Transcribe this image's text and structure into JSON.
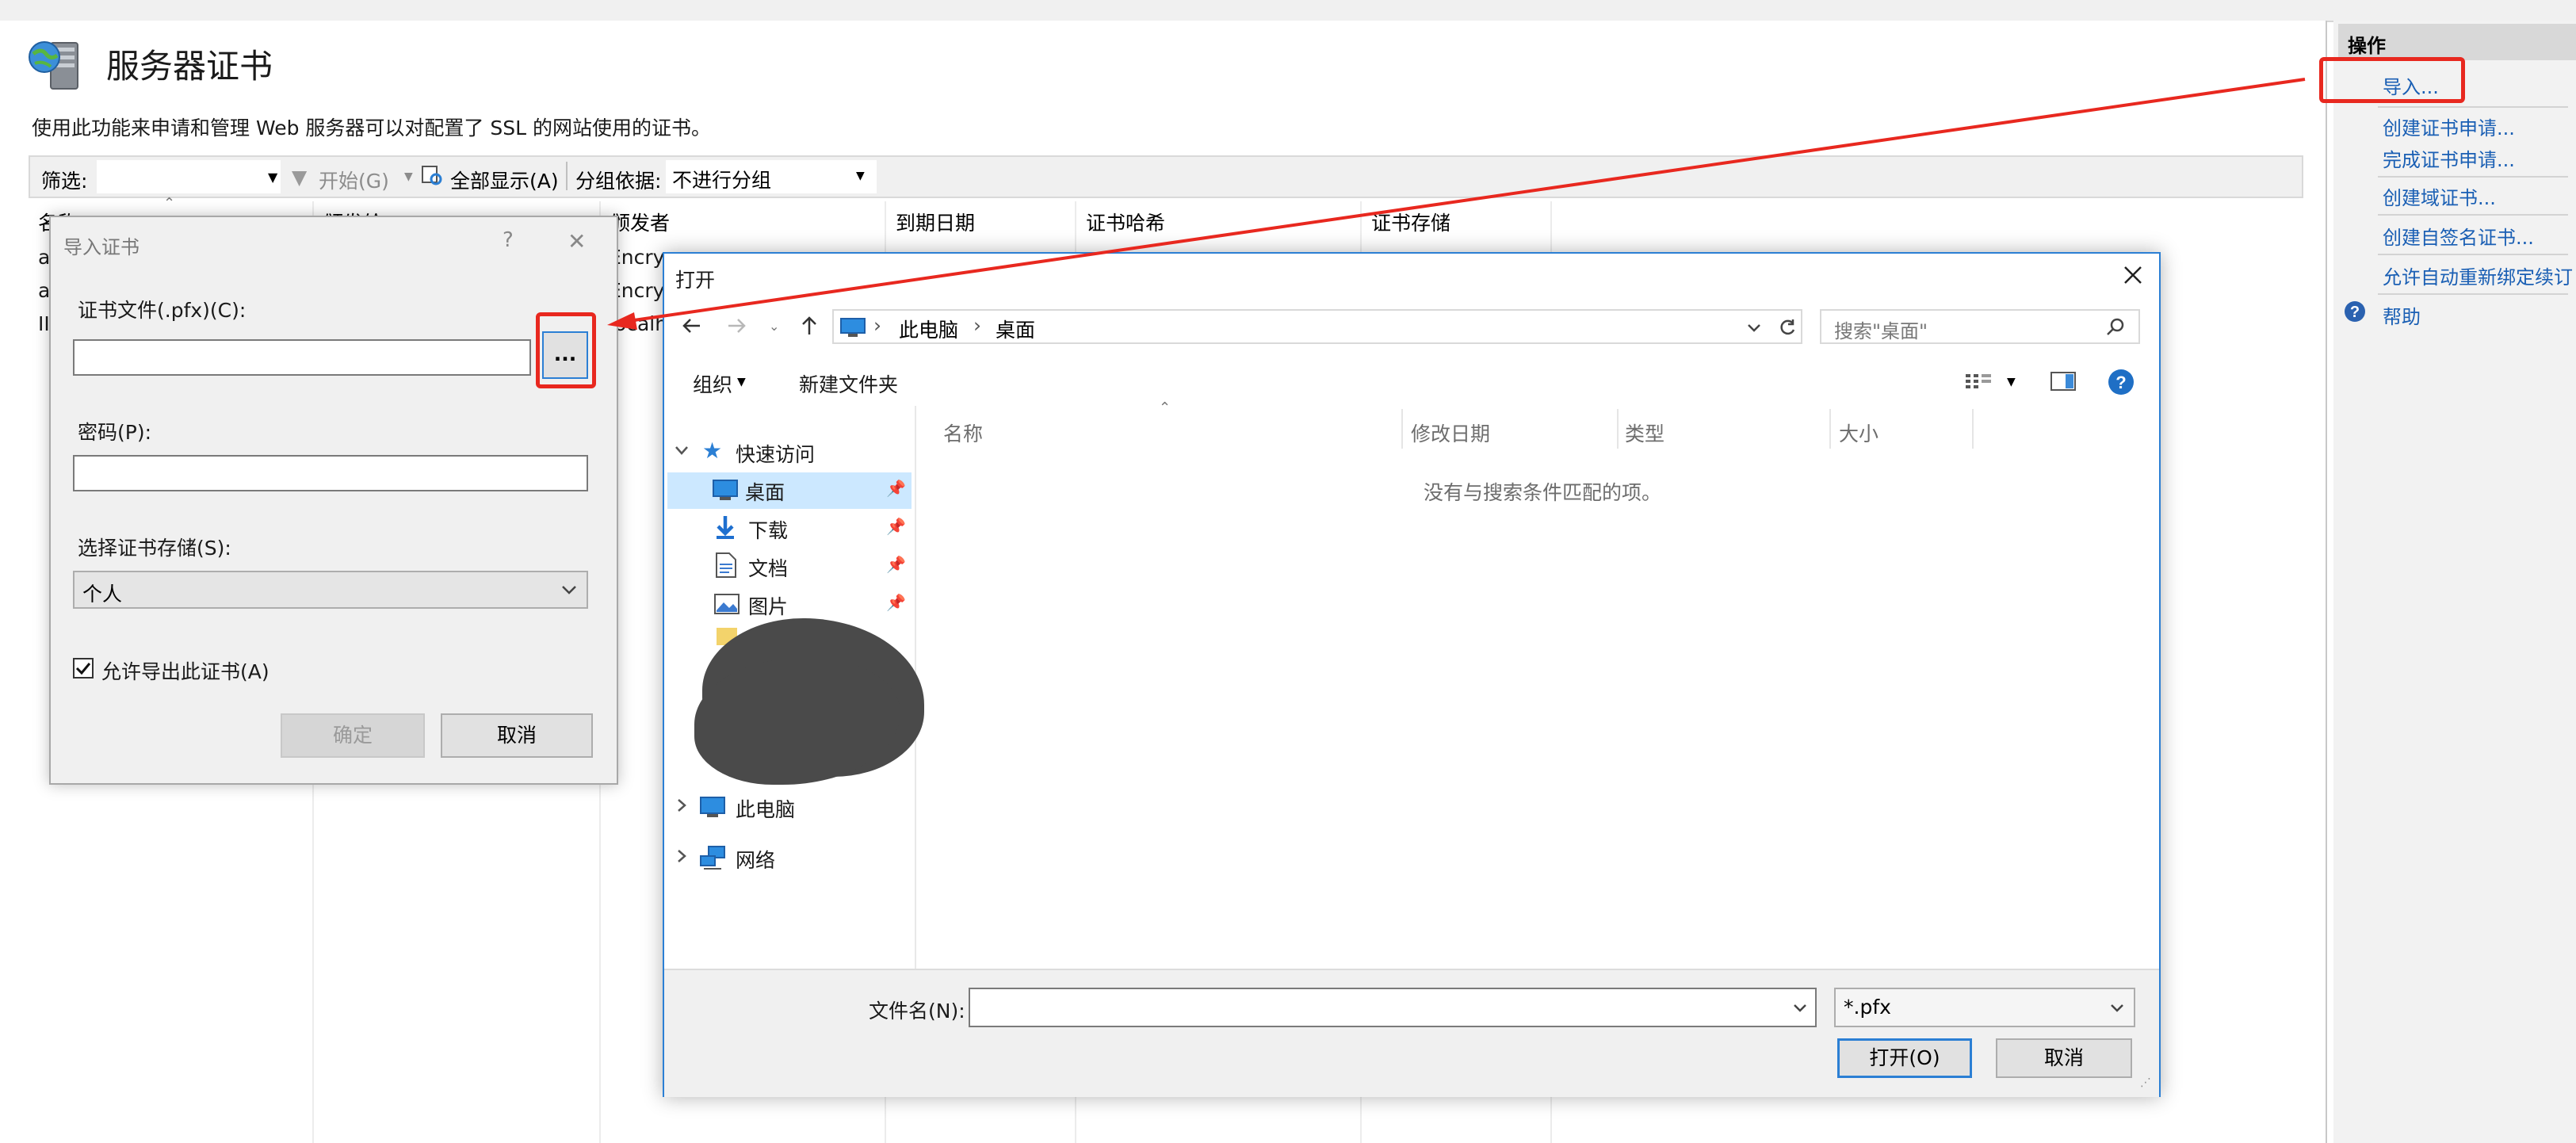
{
  "main": {
    "title": "服务器证书",
    "description": "使用此功能来申请和管理 Web 服务器可以对配置了 SSL 的网站使用的证书。",
    "toolbar": {
      "filter_label": "筛选:",
      "start_label": "开始(G)",
      "show_all_label": "全部显示(A)",
      "group_by_label": "分组依据:",
      "group_by_value": "不进行分组"
    },
    "columns": [
      "名称",
      "颁发给",
      "颁发者",
      "到期日期",
      "证书哈希",
      "证书存储"
    ],
    "row_fragments": [
      "a",
      "a",
      "II",
      "Encryp",
      "Encryp",
      "localh"
    ]
  },
  "actions": {
    "header": "操作",
    "links": [
      "导入...",
      "创建证书申请...",
      "完成证书申请...",
      "创建域证书...",
      "创建自签名证书...",
      "允许自动重新绑定续订",
      "帮助"
    ]
  },
  "import_dialog": {
    "title": "导入证书",
    "help_glyph": "?",
    "close_glyph": "✕",
    "file_label": "证书文件(.pfx)(C):",
    "file_value": "",
    "browse_label": "...",
    "password_label": "密码(P):",
    "password_value": "",
    "store_label": "选择证书存储(S):",
    "store_value": "个人",
    "export_label": "允许导出此证书(A)",
    "export_checked": true,
    "ok_label": "确定",
    "cancel_label": "取消"
  },
  "open_dialog": {
    "title": "打开",
    "breadcrumb": [
      "此电脑",
      "桌面"
    ],
    "search_placeholder": "搜索\"桌面\"",
    "organize_label": "组织",
    "new_folder_label": "新建文件夹",
    "columns": [
      "名称",
      "修改日期",
      "类型",
      "大小"
    ],
    "empty_message": "没有与搜索条件匹配的项。",
    "nav": {
      "quick_access": "快速访问",
      "items": [
        "桌面",
        "下载",
        "文档",
        "图片"
      ],
      "this_pc": "此电脑",
      "network": "网络"
    },
    "filename_label": "文件名(N):",
    "filename_value": "",
    "filetype_value": "*.pfx",
    "open_label": "打开(O)",
    "cancel_label": "取消"
  },
  "colors": {
    "accent": "#2b7fd4",
    "highlight": "#e8281f",
    "link": "#1a5fb4",
    "selection": "#cce8ff"
  }
}
